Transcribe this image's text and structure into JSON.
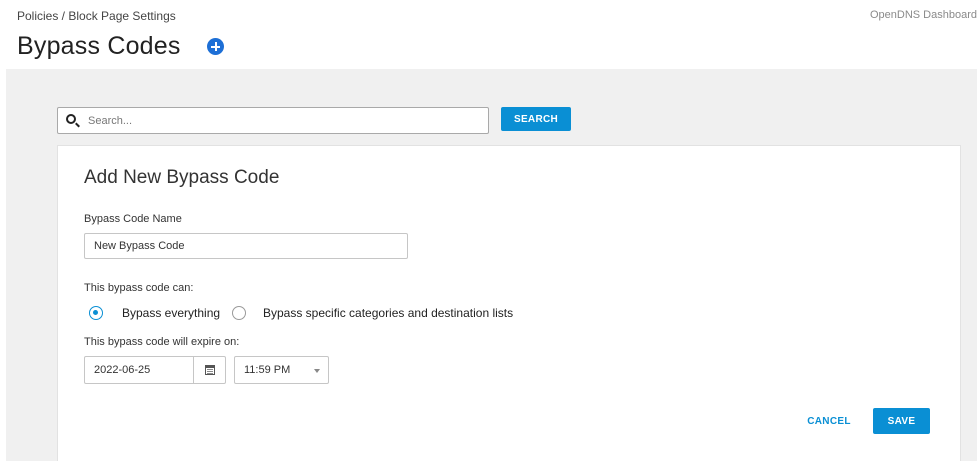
{
  "header": {
    "breadcrumb": "Policies / Block Page Settings",
    "top_right": "OpenDNS Dashboard",
    "title": "Bypass Codes",
    "add_icon": "plus-circle-icon"
  },
  "search": {
    "placeholder": "Search...",
    "value": "",
    "button_label": "SEARCH",
    "icon": "search-icon"
  },
  "form": {
    "title": "Add New Bypass Code",
    "name_label": "Bypass Code Name",
    "name_value": "New Bypass Code",
    "can_label": "This bypass code can:",
    "options": [
      {
        "label": "Bypass everything",
        "selected": true
      },
      {
        "label": "Bypass specific categories and destination lists",
        "selected": false
      }
    ],
    "expire_label": "This bypass code will expire on:",
    "date_value": "2022-06-25",
    "time_value": "11:59 PM",
    "cancel_label": "CANCEL",
    "save_label": "SAVE"
  },
  "colors": {
    "accent": "#0a8fd4",
    "add_icon": "#1d6fd6",
    "background": "#f0f0f0"
  }
}
